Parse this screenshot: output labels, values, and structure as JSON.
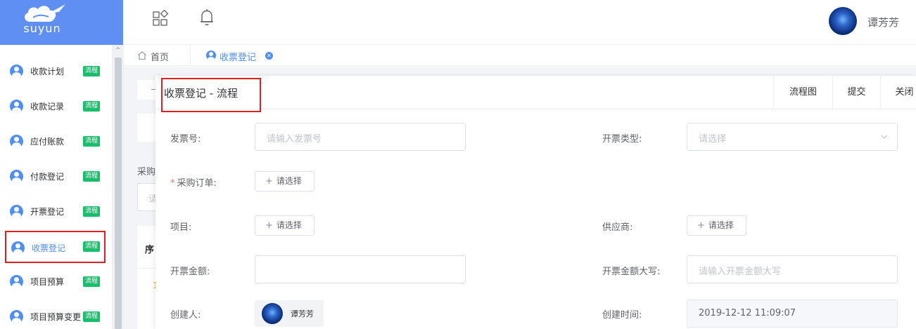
{
  "brand": {
    "name": "suyun"
  },
  "sidebar": {
    "items": [
      {
        "label": "收款计划",
        "tag": "流程",
        "active": false
      },
      {
        "label": "收款记录",
        "tag": "流程",
        "active": false
      },
      {
        "label": "应付账款",
        "tag": "流程",
        "active": false
      },
      {
        "label": "付款登记",
        "tag": "流程",
        "active": false
      },
      {
        "label": "开票登记",
        "tag": "流程",
        "active": false
      },
      {
        "label": "收票登记",
        "tag": "流程",
        "active": true
      },
      {
        "label": "项目预算",
        "tag": "流程",
        "active": false
      },
      {
        "label": "项目预算变更",
        "tag": "流程",
        "active": false
      }
    ]
  },
  "header": {
    "icons": [
      "apps-grid-icon",
      "bell-icon"
    ],
    "user_name": "谭芳芳"
  },
  "tabs": [
    {
      "label": "首页",
      "icon": "home-icon",
      "active": false
    },
    {
      "label": "收票登记",
      "icon": "user-icon",
      "active": true
    }
  ],
  "background_page": {
    "fragments": [
      "采购",
      "请",
      "序"
    ]
  },
  "dialog": {
    "title": "收票登记  -  流程",
    "actions": [
      "流程图",
      "提交",
      "关闭"
    ],
    "fields": {
      "invoice_no": {
        "label": "发票号:",
        "placeholder": "请输入发票号"
      },
      "invoice_type": {
        "label": "开票类型:",
        "placeholder": "请选择"
      },
      "purchase_order": {
        "label": "采购订单:",
        "required": true,
        "button": "请选择"
      },
      "project": {
        "label": "项目:",
        "button": "请选择"
      },
      "supplier": {
        "label": "供应商:",
        "button": "请选择"
      },
      "amount": {
        "label": "开票金额:",
        "value": ""
      },
      "amount_upper": {
        "label": "开票金额大写:",
        "placeholder": "请输入开票金额大写"
      },
      "creator": {
        "label": "创建人:",
        "name": "谭芳芳"
      },
      "created_at": {
        "label": "创建时间:",
        "value": "2019-12-12 11:09:07"
      }
    }
  },
  "colors": {
    "brand": "#5f8ff3",
    "accent": "#4f8ef7",
    "tag_green": "#19be6b",
    "highlight_red": "#e02020",
    "required_red": "#f56c6c"
  }
}
